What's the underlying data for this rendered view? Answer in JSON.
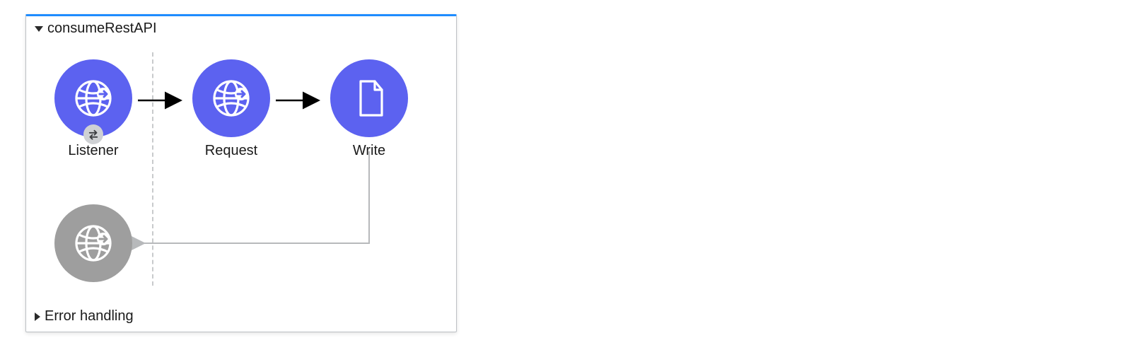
{
  "flow": {
    "title": "consumeRestAPI",
    "error_section_title": "Error handling",
    "nodes": {
      "listener": {
        "label": "Listener"
      },
      "request": {
        "label": "Request"
      },
      "write": {
        "label": "Write"
      }
    }
  },
  "chart_data": {
    "type": "flow-diagram",
    "title": "consumeRestAPI",
    "nodes": [
      {
        "id": "listener",
        "label": "Listener",
        "kind": "http-listener",
        "role": "source",
        "color": "blue"
      },
      {
        "id": "request",
        "label": "Request",
        "kind": "http-request",
        "role": "processor",
        "color": "blue"
      },
      {
        "id": "write",
        "label": "Write",
        "kind": "file-write",
        "role": "processor",
        "color": "blue"
      },
      {
        "id": "response",
        "label": "",
        "kind": "http-response",
        "role": "response",
        "color": "grey"
      }
    ],
    "edges": [
      {
        "from": "listener",
        "to": "request",
        "style": "solid"
      },
      {
        "from": "request",
        "to": "write",
        "style": "solid"
      },
      {
        "from": "write",
        "to": "response",
        "style": "return",
        "color": "grey"
      }
    ],
    "sections": [
      {
        "name": "consumeRestAPI",
        "expanded": true
      },
      {
        "name": "Error handling",
        "expanded": false
      }
    ]
  }
}
